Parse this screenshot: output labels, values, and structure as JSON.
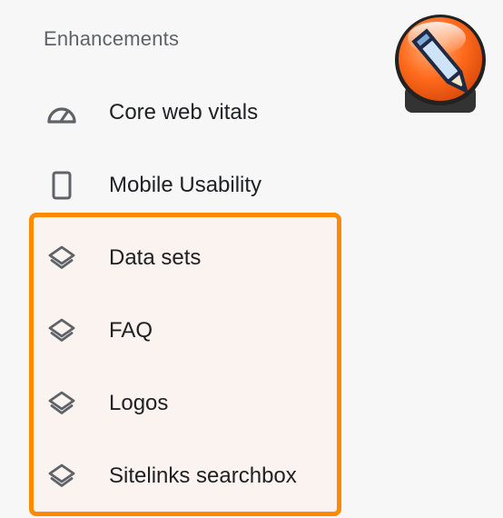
{
  "enhancements": {
    "title": "Enhancements",
    "items": [
      {
        "label": "Core web vitals",
        "icon": "speedometer-icon"
      },
      {
        "label": "Mobile Usability",
        "icon": "smartphone-icon"
      },
      {
        "label": "Data sets",
        "icon": "layers-icon"
      },
      {
        "label": "FAQ",
        "icon": "layers-icon"
      },
      {
        "label": "Logos",
        "icon": "layers-icon"
      },
      {
        "label": "Sitelinks searchbox",
        "icon": "layers-icon"
      }
    ]
  },
  "colors": {
    "highlight_border": "#ff8a00",
    "highlight_fill": "#fbf3ef",
    "text": "#202124",
    "muted": "#5f6368",
    "icon": "#5f6368"
  }
}
